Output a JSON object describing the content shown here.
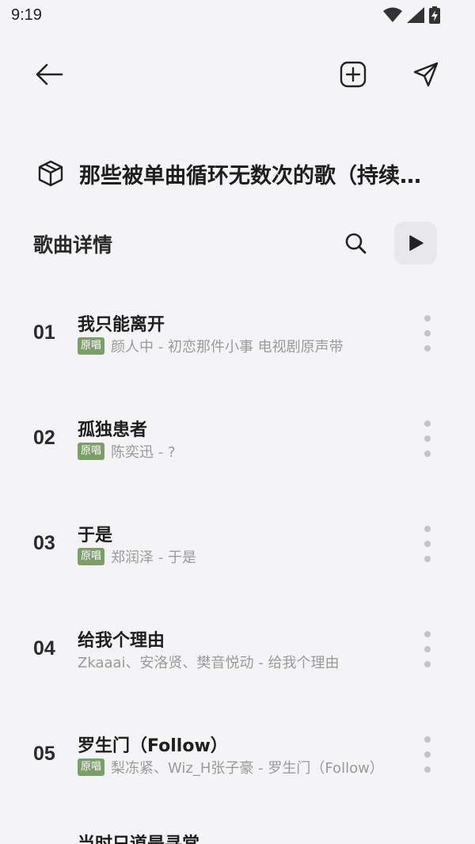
{
  "status_bar": {
    "time": "9:19"
  },
  "toolbar": {
    "back_icon": "arrow-left-icon",
    "add_icon": "plus-square-icon",
    "share_icon": "send-icon"
  },
  "playlist": {
    "icon": "cube-icon",
    "title": "那些被单曲循环无数次的歌（持续更新）"
  },
  "section": {
    "label": "歌曲详情",
    "search_icon": "search-icon",
    "play_icon": "play-icon"
  },
  "badge_label": "原唱",
  "songs": [
    {
      "index": "01",
      "title": "我只能离开",
      "artist": "颜人中 - 初恋那件小事 电视剧原声带",
      "badge": true
    },
    {
      "index": "02",
      "title": "孤独患者",
      "artist": "陈奕迅 - ?",
      "badge": true
    },
    {
      "index": "03",
      "title": "于是",
      "artist": "郑润泽 - 于是",
      "badge": true
    },
    {
      "index": "04",
      "title": "给我个理由",
      "artist": "Zkaaai、安洛贤、樊音悦动 - 给我个理由",
      "badge": false
    },
    {
      "index": "05",
      "title": "罗生门（Follow）",
      "artist": "梨冻紧、Wiz_H张子豪 - 罗生门（Follow）",
      "badge": true
    }
  ],
  "partial_next_title": "当时只道是寻常",
  "colors": {
    "background": "#f4f4f6",
    "badge": "#7c9f6a",
    "secondary_text": "#9a9a9a"
  }
}
